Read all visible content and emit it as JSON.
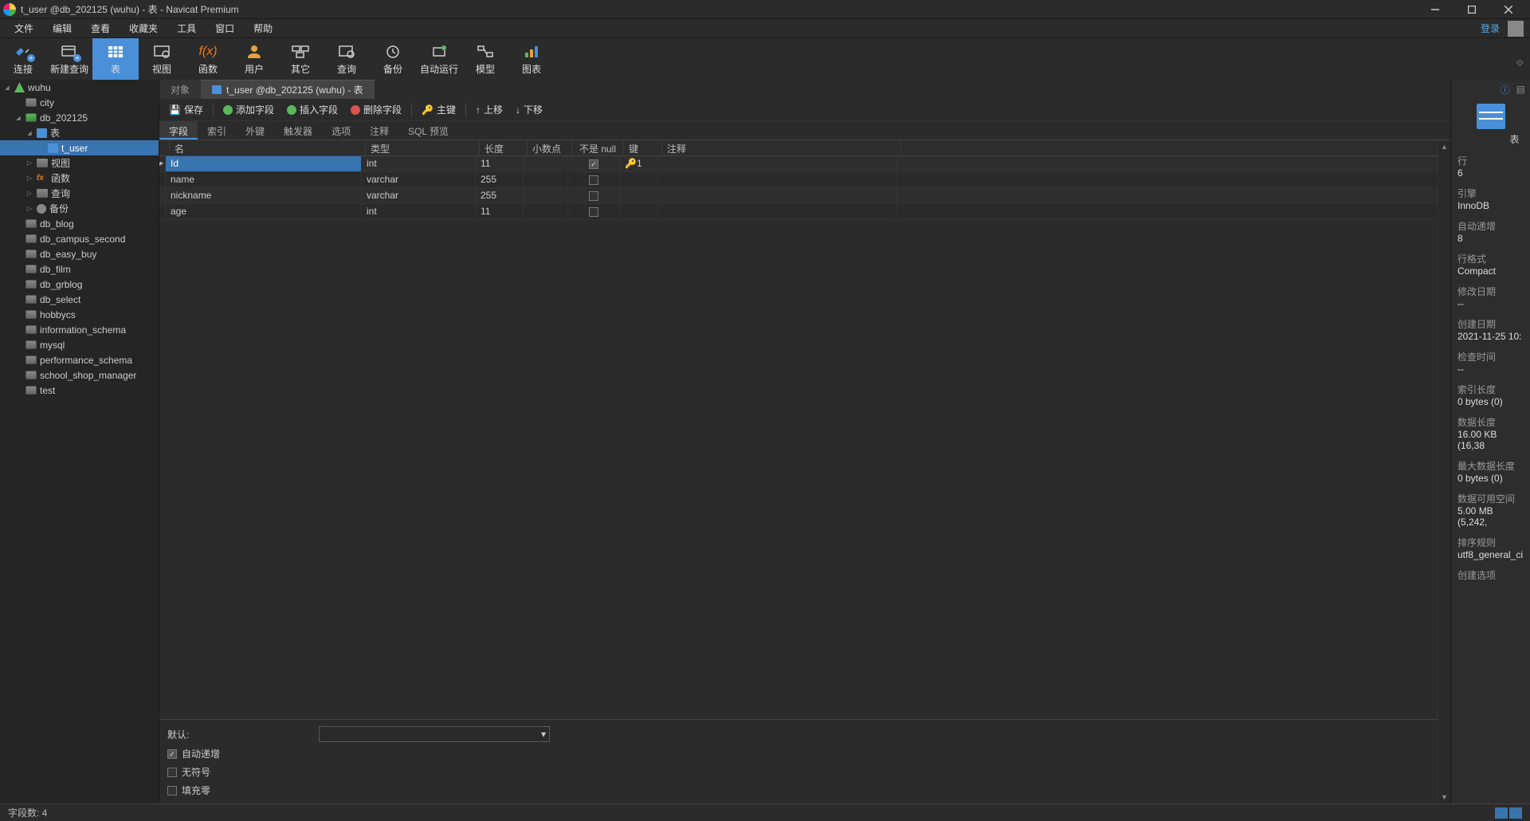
{
  "window": {
    "title": "t_user @db_202125 (wuhu) - 表 - Navicat Premium"
  },
  "menu": {
    "items": [
      "文件",
      "编辑",
      "查看",
      "收藏夹",
      "工具",
      "窗口",
      "帮助"
    ],
    "login": "登录"
  },
  "toolbar": {
    "items": [
      "连接",
      "新建查询",
      "表",
      "视图",
      "函数",
      "用户",
      "其它",
      "查询",
      "备份",
      "自动运行",
      "模型",
      "图表"
    ]
  },
  "sidebar": {
    "connection": "wuhu",
    "items": [
      {
        "name": "city",
        "depth": 1,
        "icon": "db"
      },
      {
        "name": "db_202125",
        "depth": 1,
        "icon": "db-green",
        "expand": "open"
      },
      {
        "name": "表",
        "depth": 2,
        "icon": "tbl",
        "expand": "open"
      },
      {
        "name": "t_user",
        "depth": 3,
        "icon": "tbl",
        "sel": true
      },
      {
        "name": "视图",
        "depth": 2,
        "icon": "view",
        "expand": "closed"
      },
      {
        "name": "函数",
        "depth": 2,
        "icon": "fx",
        "expand": "closed"
      },
      {
        "name": "查询",
        "depth": 2,
        "icon": "view",
        "expand": "closed"
      },
      {
        "name": "备份",
        "depth": 2,
        "icon": "gear",
        "expand": "closed"
      },
      {
        "name": "db_blog",
        "depth": 1,
        "icon": "db"
      },
      {
        "name": "db_campus_second",
        "depth": 1,
        "icon": "db"
      },
      {
        "name": "db_easy_buy",
        "depth": 1,
        "icon": "db"
      },
      {
        "name": "db_film",
        "depth": 1,
        "icon": "db"
      },
      {
        "name": "db_grblog",
        "depth": 1,
        "icon": "db"
      },
      {
        "name": "db_select",
        "depth": 1,
        "icon": "db"
      },
      {
        "name": "hobbycs",
        "depth": 1,
        "icon": "db"
      },
      {
        "name": "information_schema",
        "depth": 1,
        "icon": "db"
      },
      {
        "name": "mysql",
        "depth": 1,
        "icon": "db"
      },
      {
        "name": "performance_schema",
        "depth": 1,
        "icon": "db"
      },
      {
        "name": "school_shop_manager",
        "depth": 1,
        "icon": "db"
      },
      {
        "name": "test",
        "depth": 1,
        "icon": "db"
      }
    ]
  },
  "tabs": {
    "t0": "对象",
    "t1": "t_user @db_202125 (wuhu) - 表"
  },
  "editorToolbar": {
    "save": "保存",
    "addField": "添加字段",
    "insertField": "插入字段",
    "deleteField": "删除字段",
    "primaryKey": "主键",
    "moveUp": "上移",
    "moveDown": "下移"
  },
  "editorTabs": {
    "items": [
      "字段",
      "索引",
      "外键",
      "触发器",
      "选项",
      "注释",
      "SQL 预览"
    ]
  },
  "columns": {
    "name": "名",
    "type": "类型",
    "length": "长度",
    "decimal": "小数点",
    "notnull": "不是 null",
    "key": "键",
    "comment": "注释"
  },
  "rows": [
    {
      "name": "Id",
      "type": "int",
      "length": "11",
      "decimal": "",
      "notnull": true,
      "key": "1",
      "sel": true
    },
    {
      "name": "name",
      "type": "varchar",
      "length": "255",
      "decimal": "",
      "notnull": false,
      "key": ""
    },
    {
      "name": "nickname",
      "type": "varchar",
      "length": "255",
      "decimal": "",
      "notnull": false,
      "key": ""
    },
    {
      "name": "age",
      "type": "int",
      "length": "11",
      "decimal": "",
      "notnull": false,
      "key": ""
    }
  ],
  "bottom": {
    "defaultLabel": "默认:",
    "autoInc": "自动递增",
    "unsigned": "无符号",
    "zerofill": "填充零"
  },
  "status": {
    "fieldCount": "字段数: 4"
  },
  "right": {
    "iconLabel": "表",
    "props": [
      {
        "label": "行",
        "value": "6"
      },
      {
        "label": "引擎",
        "value": "InnoDB"
      },
      {
        "label": "自动递增",
        "value": "8"
      },
      {
        "label": "行格式",
        "value": "Compact"
      },
      {
        "label": "修改日期",
        "value": "--"
      },
      {
        "label": "创建日期",
        "value": "2021-11-25 10:"
      },
      {
        "label": "检查时间",
        "value": "--"
      },
      {
        "label": "索引长度",
        "value": "0 bytes (0)"
      },
      {
        "label": "数据长度",
        "value": "16.00 KB (16,38"
      },
      {
        "label": "最大数据长度",
        "value": "0 bytes (0)"
      },
      {
        "label": "数据可用空间",
        "value": "5.00 MB (5,242,"
      },
      {
        "label": "排序规则",
        "value": "utf8_general_ci"
      },
      {
        "label": "创建选项",
        "value": ""
      }
    ]
  }
}
